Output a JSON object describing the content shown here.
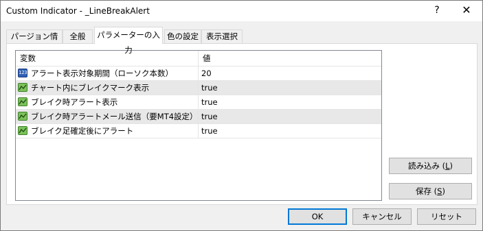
{
  "window": {
    "title": "Custom Indicator - _LineBreakAlert",
    "help_glyph": "?",
    "close_glyph": "✕"
  },
  "tabs": [
    {
      "label": "パージョン情報"
    },
    {
      "label": "全般"
    },
    {
      "label": "パラメーターの入力",
      "active": true
    },
    {
      "label": "色の設定"
    },
    {
      "label": "表示選択"
    }
  ],
  "table": {
    "headers": {
      "name": "変数",
      "value": "値"
    },
    "rows": [
      {
        "icon": "number-icon",
        "icon_text": "123",
        "name": "アラート表示対象期間（ローソク本数）",
        "value": "20"
      },
      {
        "icon": "boolean-icon",
        "name": "チャート内にブレイクマーク表示",
        "value": "true"
      },
      {
        "icon": "boolean-icon",
        "name": "ブレイク時アラート表示",
        "value": "true"
      },
      {
        "icon": "boolean-icon",
        "name": "ブレイク時アラートメール送信（要MT4設定）",
        "value": "true"
      },
      {
        "icon": "boolean-icon",
        "name": "ブレイク足確定後にアラート",
        "value": "true"
      }
    ]
  },
  "side_buttons": {
    "load_label": "読み込み (",
    "load_key": "L",
    "load_end": ")",
    "save_label": "保存 (",
    "save_key": "S",
    "save_end": ")"
  },
  "footer_buttons": {
    "ok": "OK",
    "cancel": "キャンセル",
    "reset": "リセット"
  },
  "colors": {
    "accent": "#0078d7",
    "row_alt": "#e8e8e8",
    "bool_icon": "#7cc15a",
    "number_icon": "#2f5fb3"
  }
}
